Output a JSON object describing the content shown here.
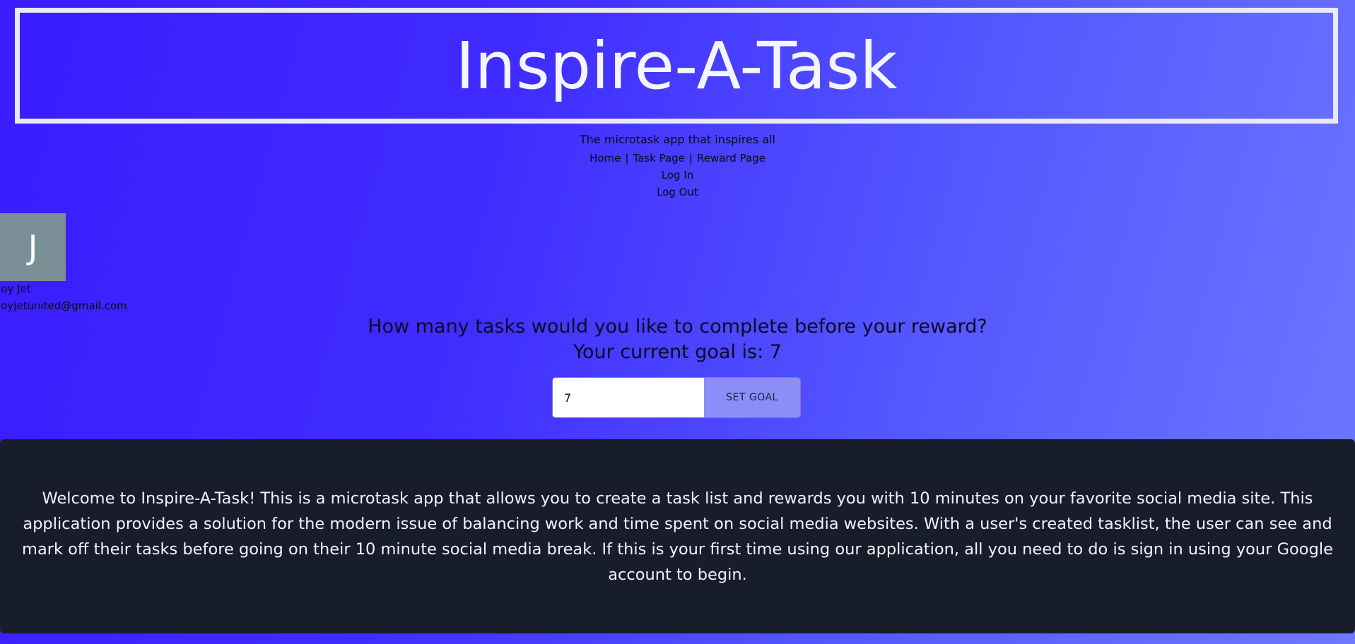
{
  "header": {
    "title": "Inspire-A-Task",
    "subtitle": "The microtask app that inspires all"
  },
  "nav": {
    "items": [
      {
        "label": "Home"
      },
      {
        "label": "Task Page"
      },
      {
        "label": "Reward Page"
      }
    ],
    "separator": "|",
    "login_label": "Log In",
    "logout_label": "Log Out"
  },
  "user": {
    "avatar_initial": "J",
    "name": "Joy Jet",
    "email": "joyjetunited@gmail.com"
  },
  "goal": {
    "question": "How many tasks would you like to complete before your reward?",
    "current_text": "Your current goal is: 7",
    "input_value": "7",
    "button_label": "SET GOAL"
  },
  "info": {
    "text": "Welcome to Inspire-A-Task! This is a microtask app that allows you to create a task list and rewards you with 10 minutes on your favorite social media site. This application provides a solution for the modern issue of balancing work and time spent on social media websites. With a user's created tasklist, the user can see and mark off their tasks before going on their 10 minute social media break. If this is your first time using our application, all you need to do is sign in using your Google account to begin."
  },
  "colors": {
    "gradient_start": "#3a1cff",
    "gradient_end": "#6f78ff",
    "title_border": "#e9eaf3",
    "avatar_bg": "#7b8f97",
    "button_bg": "#8a8ff8",
    "panel_bg": "#181d2b"
  }
}
